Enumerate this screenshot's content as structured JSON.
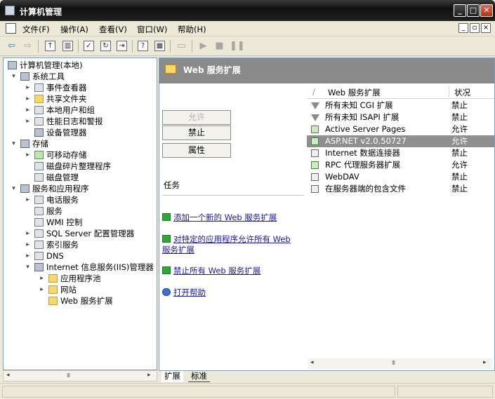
{
  "window": {
    "title": "计算机管理"
  },
  "menu": {
    "items": [
      "文件(F)",
      "操作(A)",
      "查看(V)",
      "窗口(W)",
      "帮助(H)"
    ],
    "mdi_minimize": "_",
    "mdi_restore": "▫",
    "mdi_close": "×"
  },
  "tree": {
    "root": "计算机管理(本地)",
    "system_tools": "系统工具",
    "event_viewer": "事件查看器",
    "shared_folders": "共享文件夹",
    "local_users": "本地用户和组",
    "perf_logs": "性能日志和警报",
    "device_manager": "设备管理器",
    "storage": "存储",
    "removable_storage": "可移动存储",
    "defrag": "磁盘碎片整理程序",
    "disk_mgmt": "磁盘管理",
    "services_apps": "服务和应用程序",
    "telephony": "电话服务",
    "services": "服务",
    "wmi": "WMI 控制",
    "sql_server": "SQL Server 配置管理器",
    "indexing": "索引服务",
    "dns": "DNS",
    "iis": "Internet 信息服务(IIS)管理器",
    "app_pools": "应用程序池",
    "websites": "网站",
    "web_ext": "Web 服务扩展"
  },
  "right": {
    "header_title": "Web 服务扩展",
    "btn_allow": "允许",
    "btn_deny": "禁止",
    "btn_props": "属性",
    "tasks_title": "任务",
    "task_add": "添加一个新的 Web 服务扩展",
    "task_allow_all_1": "对特定的应用程序允许所有 Web",
    "task_allow_all_2": "服务扩展",
    "task_deny_all": "禁止所有 Web 服务扩展",
    "task_help": "打开帮助"
  },
  "list": {
    "col_name": "Web 服务扩展",
    "col_status": "状况",
    "rows": [
      {
        "name": "所有未知 CGI 扩展",
        "status": "禁止"
      },
      {
        "name": "所有未知 ISAPI 扩展",
        "status": "禁止"
      },
      {
        "name": "Active Server Pages",
        "status": "允许"
      },
      {
        "name": "ASP.NET v2.0.50727",
        "status": "允许"
      },
      {
        "name": "Internet 数据连接器",
        "status": "禁止"
      },
      {
        "name": "RPC 代理服务器扩展",
        "status": "允许"
      },
      {
        "name": "WebDAV",
        "status": "禁止"
      },
      {
        "name": "在服务器端的包含文件",
        "status": "禁止"
      }
    ]
  },
  "tabs": {
    "extended": "扩展",
    "standard": "标准"
  },
  "scroll": {
    "grip": "III"
  }
}
